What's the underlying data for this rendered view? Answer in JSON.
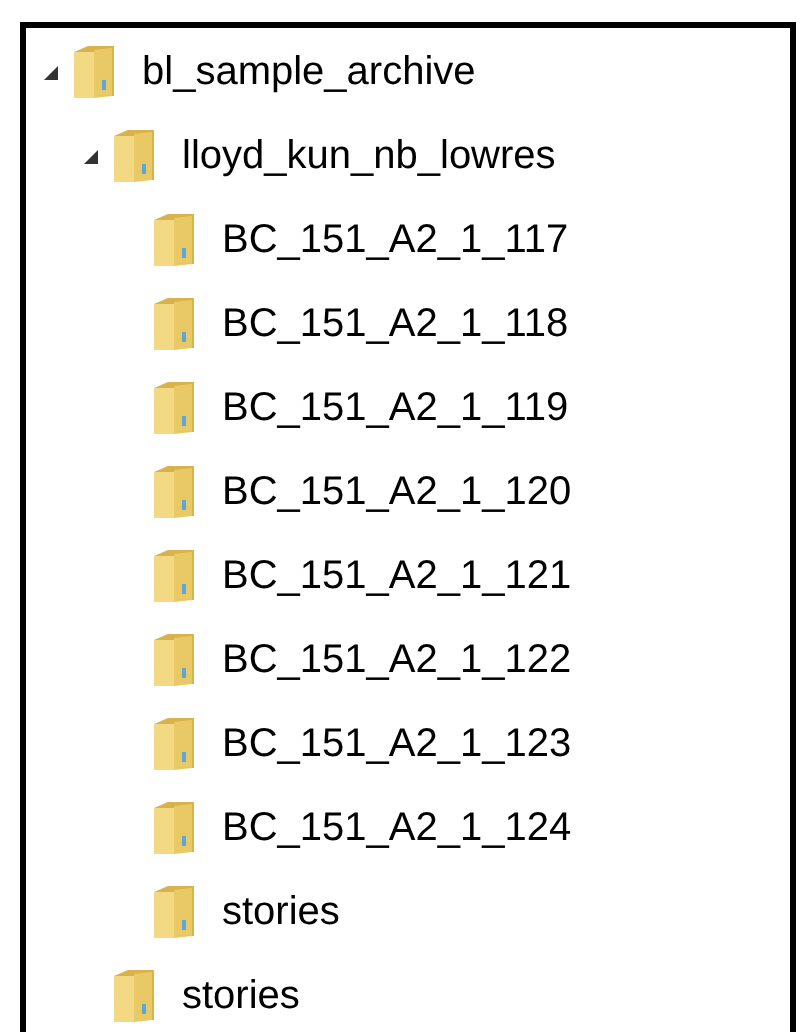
{
  "tree": [
    {
      "label": "bl_sample_archive",
      "expanded": true,
      "children": [
        {
          "label": "lloyd_kun_nb_lowres",
          "expanded": true,
          "children": [
            {
              "label": "BC_151_A2_1_117"
            },
            {
              "label": "BC_151_A2_1_118"
            },
            {
              "label": "BC_151_A2_1_119"
            },
            {
              "label": "BC_151_A2_1_120"
            },
            {
              "label": "BC_151_A2_1_121"
            },
            {
              "label": "BC_151_A2_1_122"
            },
            {
              "label": "BC_151_A2_1_123"
            },
            {
              "label": "BC_151_A2_1_124"
            },
            {
              "label": "stories"
            }
          ]
        },
        {
          "label": "stories"
        }
      ]
    }
  ]
}
